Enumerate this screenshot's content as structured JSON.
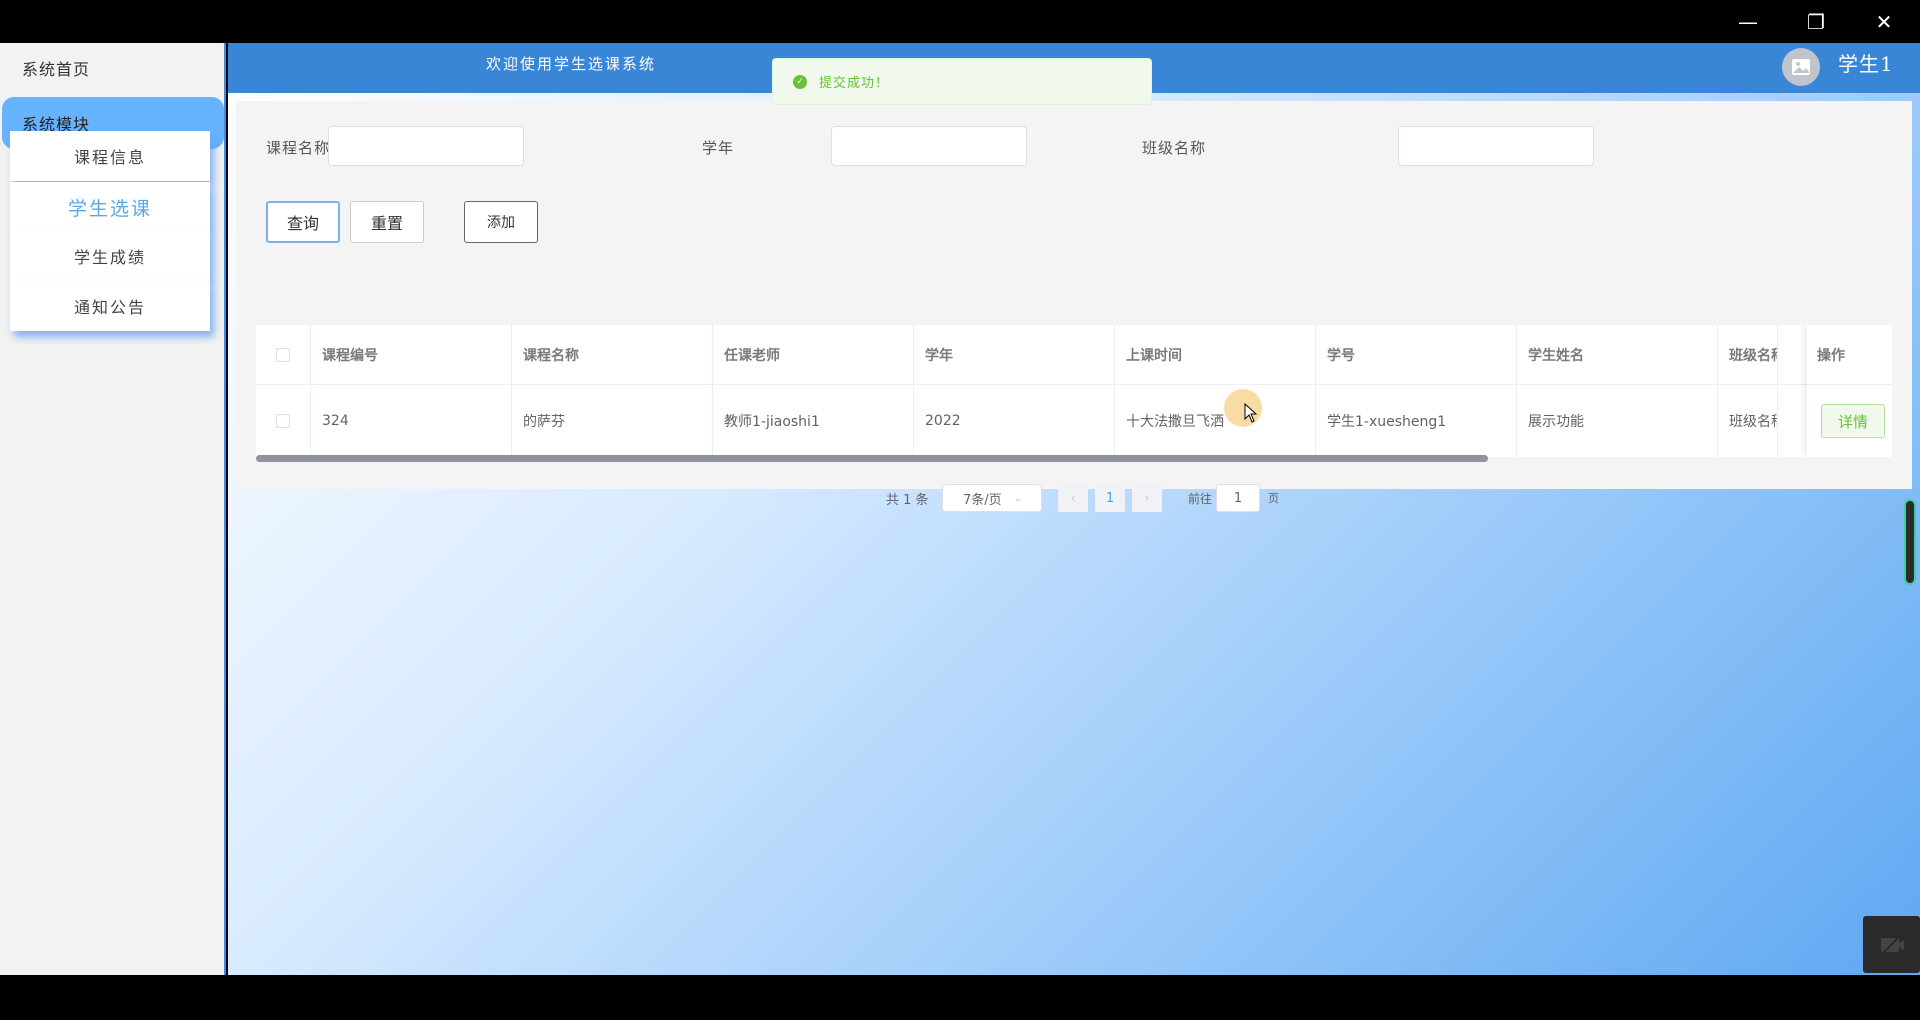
{
  "window": {
    "minimize": "—",
    "maximize": "❐",
    "close": "✕"
  },
  "sidebar": {
    "home": "系统首页",
    "module": "系统模块",
    "items": [
      {
        "label": "课程信息"
      },
      {
        "label": "学生选课"
      },
      {
        "label": "学生成绩"
      },
      {
        "label": "通知公告"
      }
    ]
  },
  "header": {
    "welcome": "欢迎使用学生选课系统",
    "username": "学生1"
  },
  "toast": {
    "text": "提交成功！"
  },
  "filters": {
    "course_name_label": "课程名称",
    "year_label": "学年",
    "class_name_label": "班级名称",
    "query": "查询",
    "reset": "重置",
    "add": "添加"
  },
  "table": {
    "columns": [
      "课程编号",
      "课程名称",
      "任课老师",
      "学年",
      "上课时间",
      "学号",
      "学生姓名",
      "班级名称",
      "操作"
    ],
    "rows": [
      [
        "324",
        "的萨芬",
        "教师1-jiaoshi1",
        "2022",
        "十大法撒旦飞洒",
        "学生1-xuesheng1",
        "展示功能",
        "班级名称"
      ]
    ],
    "detail_button": "详情"
  },
  "pagination": {
    "total": "共 1 条",
    "page_size": "7条/页",
    "current_page": "1",
    "goto_label": "前往",
    "goto_value": "1",
    "page_suffix": "页"
  },
  "colors": {
    "accent": "#3a86d6",
    "sidebar_active": "#66b3ff",
    "success": "#67c23a"
  }
}
